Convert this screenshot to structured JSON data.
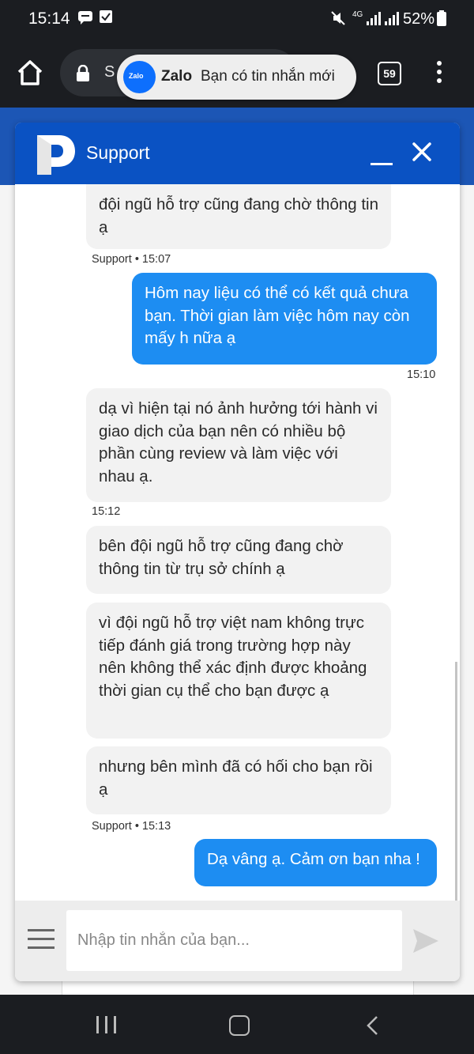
{
  "status_bar": {
    "time": "15:14",
    "network": "4G",
    "battery": "52%"
  },
  "browser": {
    "url_partial": "S",
    "tabs_count": "59"
  },
  "notification": {
    "app_icon_text": "Zalo",
    "app": "Zalo",
    "message": "Bạn có tin nhắn mới"
  },
  "chat": {
    "title": "Support",
    "messages": [
      {
        "sender": "support",
        "text": "đội ngũ hỗ trợ cũng đang chờ thông tin ạ"
      },
      {
        "meta": "Support • 15:07"
      },
      {
        "sender": "user",
        "text": "Hôm nay liệu có thể có kết quả chưa bạn.  Thời gian làm việc hôm nay còn mấy h nữa ạ"
      },
      {
        "meta": "15:10"
      },
      {
        "sender": "support",
        "text": "dạ vì hiện tại nó ảnh hưởng tới hành vi giao dịch của bạn nên có nhiều bộ phần cùng review và làm việc với nhau ạ."
      },
      {
        "meta": "15:12"
      },
      {
        "sender": "support",
        "text": "bên đội ngũ hỗ trợ cũng đang chờ thông tin từ trụ sở chính ạ"
      },
      {
        "sender": "support",
        "text": "vì đội ngũ hỗ trợ việt nam không trực tiếp đánh giá trong trường hợp này nên không thể xác định được khoảng thời gian cụ thể cho bạn được ạ"
      },
      {
        "sender": "support",
        "text": "nhưng bên mình đã có hối cho bạn rồi ạ"
      },
      {
        "meta": "Support • 15:13"
      },
      {
        "sender": "user",
        "text": "Dạ vâng ạ. Cảm ơn bạn nha !"
      }
    ],
    "input_placeholder": "Nhập tin nhắn của bạn..."
  },
  "colors": {
    "header_blue": "#0a52c3",
    "user_bubble": "#1d8df2",
    "support_bubble": "#f2f2f2"
  },
  "icons": [
    "home-icon",
    "lock-icon",
    "menu-dots-icon",
    "minimize-icon",
    "close-icon",
    "hamburger-icon",
    "send-icon",
    "mute-icon",
    "battery-icon"
  ]
}
